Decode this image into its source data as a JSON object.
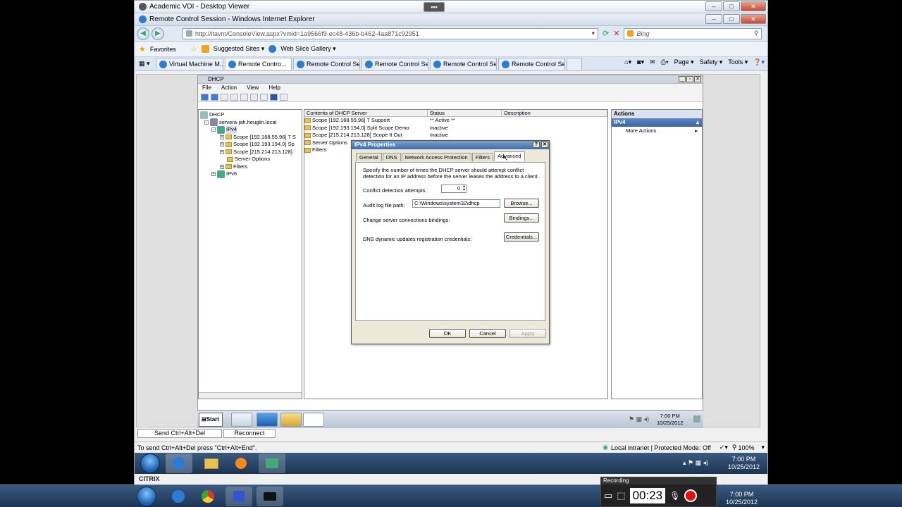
{
  "citrix_window": {
    "title": "Academic VDI - Desktop Viewer"
  },
  "ie": {
    "title": "Remote Control Session - Windows Internet Explorer",
    "url": "http://itavm/ConsoleView.aspx?vmid=1a9566f9-ec48-436b-b462-4aa871c92951",
    "search_placeholder": "Bing",
    "favorites": {
      "label": "Favorites",
      "items": [
        "Suggested Sites ▾",
        "Web Slice Gallery ▾"
      ]
    },
    "tabs": [
      "Virtual Machine M...",
      "Remote Contro...",
      "Remote Control Se...",
      "Remote Control Se...",
      "Remote Control Se...",
      "Remote Control Se..."
    ],
    "command_bar": {
      "page": "Page ▾",
      "safety": "Safety ▾",
      "tools": "Tools ▾"
    },
    "status": {
      "hint": "To send Ctrl+Alt+Del press \"Ctrl+Alt+End\".",
      "zone": "Local intranet | Protected Mode: Off",
      "zoom": "100%"
    }
  },
  "rdp_buttons": {
    "send_cad": "Send Ctrl+Alt+Del",
    "reconnect": "Reconnect"
  },
  "mmc": {
    "title": "DHCP",
    "menu": [
      "File",
      "Action",
      "View",
      "Help"
    ],
    "tree": [
      "DHCP",
      "servera-jah.heuglin.local",
      "IPv4",
      "Scope [192.168.55.96] 7 S",
      "Scope [192.193.194.0] Sp",
      "Scope [215.214.213.128]",
      "Server Options",
      "Filters",
      "IPv6"
    ],
    "columns": [
      "Contents of DHCP Server",
      "Status",
      "Description"
    ],
    "rows": [
      {
        "name": "Scope [192.168.55.96] 7 Support",
        "status": "** Active **"
      },
      {
        "name": "Scope [192.193.194.0] Split Scope Demo",
        "status": "Inactive"
      },
      {
        "name": "Scope [215.214.213.128] Scope It Out",
        "status": "Inactive"
      },
      {
        "name": "Server Options",
        "status": ""
      },
      {
        "name": "Filters",
        "status": ""
      }
    ],
    "actions": {
      "header": "Actions",
      "section": "IPv4",
      "more": "More Actions"
    }
  },
  "dialog": {
    "title": "IPv4 Properties",
    "tabs": [
      "General",
      "DNS",
      "Network Access Protection",
      "Filters",
      "Advanced"
    ],
    "description": "Specify the number of times the DHCP server should attempt conflict detection for an IP address before the server leases the address to a client.",
    "conflict_label": "Conflict detection attempts:",
    "conflict_value": "0",
    "audit_label": "Audit log file path:",
    "audit_value": "C:\\Windows\\system32\\dhcp",
    "browse": "Browse...",
    "bindings_label": "Change server connections bindings:",
    "bindings": "Bindings...",
    "dns_label": "DNS dynamic updates registration credentials:",
    "credentials": "Credentials...",
    "ok": "OK",
    "cancel": "Cancel",
    "apply": "Apply"
  },
  "remote_taskbar": {
    "start": "Start",
    "time": "7:00 PM",
    "date": "10/25/2012"
  },
  "host_taskbar": {
    "time": "7:00 PM",
    "date": "10/25/2012",
    "brand": "CITRIX"
  },
  "recording": {
    "label": "Recording",
    "timer": "00:23"
  }
}
